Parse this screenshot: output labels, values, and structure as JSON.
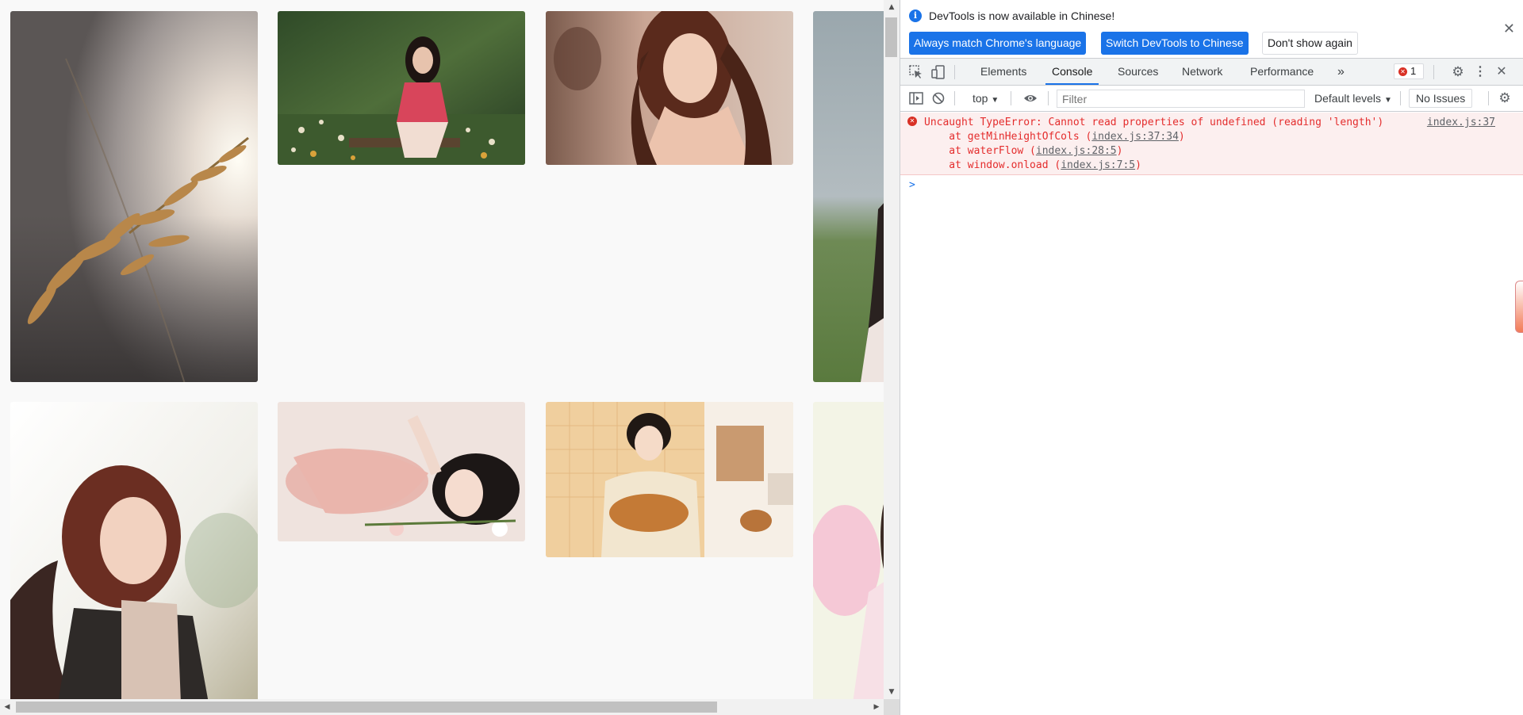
{
  "page": {
    "images": [
      {
        "alt": "wheat-grass-sunset-photo"
      },
      {
        "alt": "girl-sitting-in-garden-photo"
      },
      {
        "alt": "woman-portrait-photo"
      },
      {
        "alt": "partial-outdoor-photo"
      },
      {
        "alt": "girl-smiling-portrait-photo"
      },
      {
        "alt": "girl-lying-on-bed-photo"
      },
      {
        "alt": "girl-in-kitchen-with-bread-photo"
      },
      {
        "alt": "partial-pink-photo"
      }
    ]
  },
  "devtools": {
    "infobar": {
      "message": "DevTools is now available in Chinese!",
      "btn_match": "Always match Chrome's language",
      "btn_switch": "Switch DevTools to Chinese",
      "btn_dont_show": "Don't show again"
    },
    "tabs": [
      "Elements",
      "Console",
      "Sources",
      "Network",
      "Performance"
    ],
    "more_tabs": "»",
    "error_count": "1",
    "console_bar": {
      "context": "top",
      "filter_placeholder": "Filter",
      "levels": "Default levels",
      "issues": "No Issues"
    },
    "error": {
      "message": "Uncaught TypeError: Cannot read properties of undefined (reading 'length')",
      "source": "index.js:37",
      "stack": [
        {
          "prefix": "    at getMinHeightOfCols (",
          "link": "index.js:37:34",
          "suffix": ")"
        },
        {
          "prefix": "    at waterFlow (",
          "link": "index.js:28:5",
          "suffix": ")"
        },
        {
          "prefix": "    at window.onload (",
          "link": "index.js:7:5",
          "suffix": ")"
        }
      ]
    },
    "prompt": ">"
  },
  "colors": {
    "accent": "#1a73e8",
    "error_text": "#e42d2d",
    "error_bg": "#fcefef"
  }
}
